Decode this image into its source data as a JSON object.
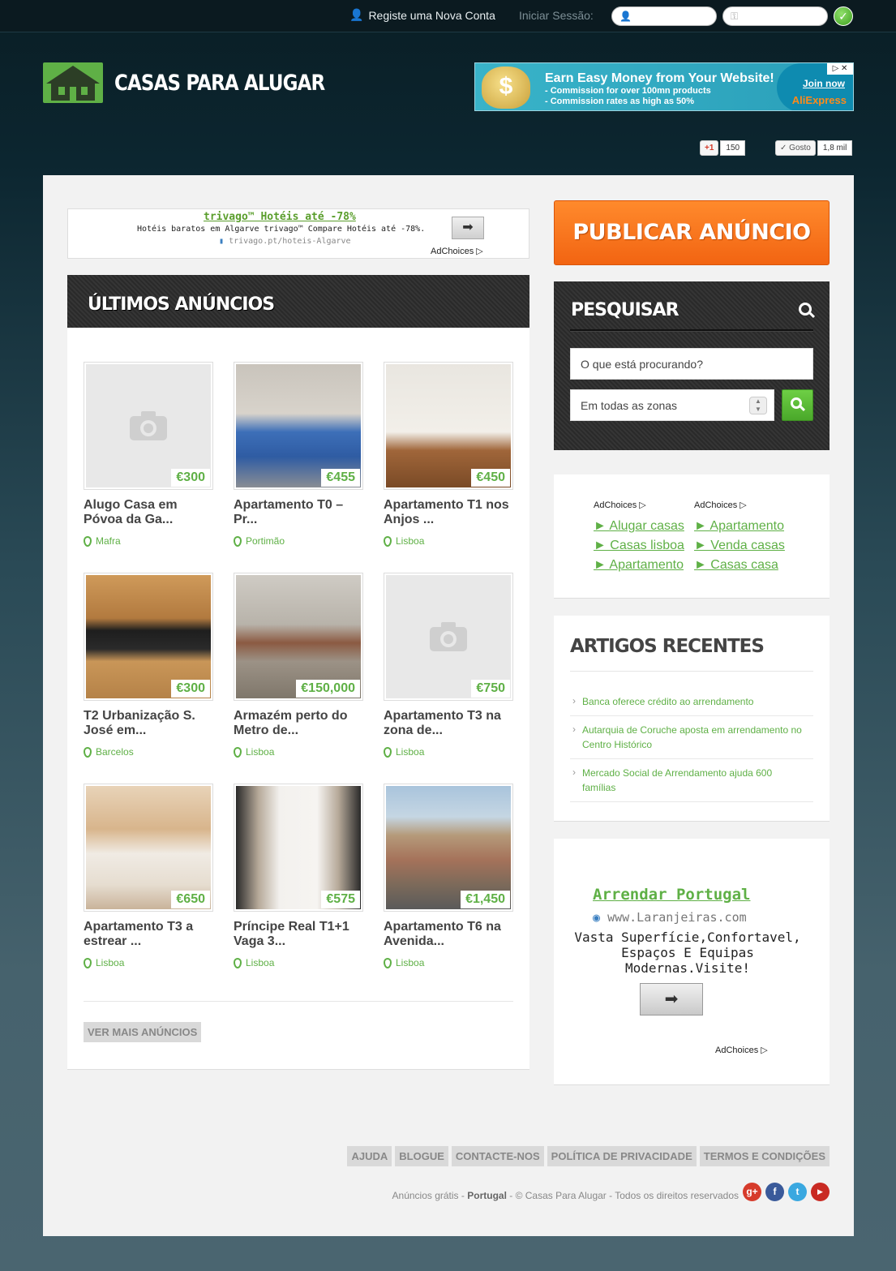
{
  "topbar": {
    "register_label": "Registe uma Nova Conta",
    "login_label": "Iniciar Sessão:",
    "user_placeholder": "",
    "password_placeholder": ""
  },
  "header": {
    "logo_text": "CASAS PARA ALUGAR",
    "ad_banner": {
      "title": "Earn Easy Money from Your Website!",
      "line1": "- Commission for over 100mn products",
      "line2": "- Commission rates as high as 50%",
      "join": "Join now",
      "brand": "AliExpress"
    },
    "gplus_label": "+1",
    "gplus_count": "150",
    "like_label": "Gosto",
    "like_count": "1,8 mil"
  },
  "ad_trivago": {
    "title": "trivago™ Hotéis até -78%",
    "desc": "Hotéis baratos em Algarve trivago™ Compare Hotéis até -78%.",
    "url": "trivago.pt/hoteis-Algarve",
    "choices": "AdChoices"
  },
  "listings": {
    "heading": "ÚLTIMOS ANÚNCIOS",
    "items": [
      {
        "title": "Alugo Casa em Póvoa da Ga...",
        "price": "€300",
        "location": "Mafra"
      },
      {
        "title": "Apartamento T0 – Pr...",
        "price": "€455",
        "location": "Portimão"
      },
      {
        "title": "Apartamento T1 nos Anjos ...",
        "price": "€450",
        "location": "Lisboa"
      },
      {
        "title": "T2 Urbanização S. José em...",
        "price": "€300",
        "location": "Barcelos"
      },
      {
        "title": "Armazém perto do Metro de...",
        "price": "€150,000",
        "location": "Lisboa"
      },
      {
        "title": "Apartamento T3 na zona de...",
        "price": "€750",
        "location": "Lisboa"
      },
      {
        "title": "Apartamento T3 a estrear ...",
        "price": "€650",
        "location": "Lisboa"
      },
      {
        "title": "Príncipe Real T1+1 Vaga 3...",
        "price": "€575",
        "location": "Lisboa"
      },
      {
        "title": "Apartamento T6 na Avenida...",
        "price": "€1,450",
        "location": "Lisboa"
      }
    ],
    "more_label": "VER MAIS ANÚNCIOS"
  },
  "sidebar": {
    "publish_label": "PUBLICAR ANÚNCIO",
    "search_title": "PESQUISAR",
    "search_placeholder": "O que está procurando?",
    "zone_value": "Em todas as zonas",
    "adlinks": {
      "choices": "AdChoices",
      "col1": [
        "► Alugar casas",
        "► Casas lisboa",
        "► Apartamento"
      ],
      "col2": [
        "► Apartamento",
        "► Venda casas",
        "► Casas casa"
      ]
    },
    "articles_title": "ARTIGOS RECENTES",
    "articles": [
      "Banca oferece crédito ao arrendamento",
      "Autarquia de Coruche aposta em arrendamento no Centro Histórico",
      "Mercado Social de Arrendamento ajuda 600 famílias"
    ],
    "ad_laranjeiras": {
      "title": "Arrendar Portugal",
      "url": "www.Laranjeiras.com",
      "desc": "Vasta Superfície,Confortavel, Espaços E Equipas Modernas.Visite!",
      "choices": "AdChoices"
    }
  },
  "footer": {
    "links": [
      "AJUDA",
      "BLOGUE",
      "CONTACTE-NOS",
      "POLÍTICA DE PRIVACIDADE",
      "TERMOS E CONDIÇÕES"
    ],
    "copy_prefix": "Anúncios grátis - ",
    "copy_country": "Portugal",
    "copy_suffix": " - © Casas Para Alugar - Todos os direitos reservados",
    "social": [
      "g+",
      "f",
      "t",
      "▶"
    ]
  }
}
